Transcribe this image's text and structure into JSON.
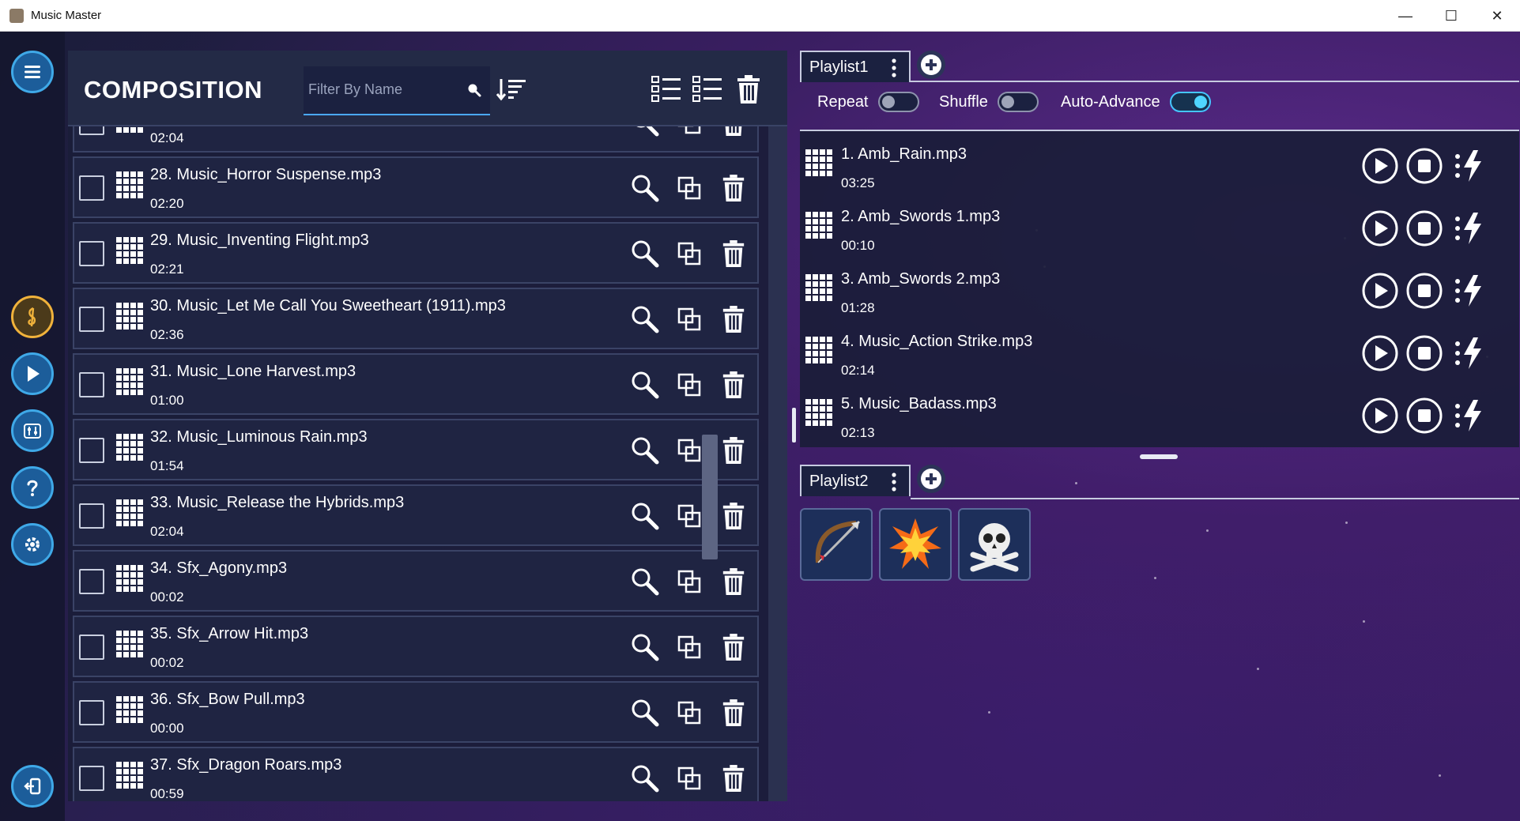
{
  "window": {
    "title": "Music Master",
    "minimize": "—",
    "maximize": "☐",
    "close": "✕"
  },
  "composition": {
    "title": "COMPOSITION",
    "filter_placeholder": "Filter By Name",
    "partial_top_row": {
      "duration": "02:04"
    },
    "tracks": [
      {
        "name": "28.  Music_Horror Suspense.mp3",
        "duration": "02:20"
      },
      {
        "name": "29.  Music_Inventing Flight.mp3",
        "duration": "02:21"
      },
      {
        "name": "30.  Music_Let Me Call You Sweetheart (1911).mp3",
        "duration": "02:36"
      },
      {
        "name": "31.  Music_Lone Harvest.mp3",
        "duration": "01:00"
      },
      {
        "name": "32.  Music_Luminous Rain.mp3",
        "duration": "01:54"
      },
      {
        "name": "33.  Music_Release the Hybrids.mp3",
        "duration": "02:04"
      },
      {
        "name": "34.  Sfx_Agony.mp3",
        "duration": "00:02"
      },
      {
        "name": "35.  Sfx_Arrow Hit.mp3",
        "duration": "00:02"
      },
      {
        "name": "36.  Sfx_Bow Pull.mp3",
        "duration": "00:00"
      },
      {
        "name": "37.  Sfx_Dragon Roars.mp3",
        "duration": "00:59"
      }
    ]
  },
  "playlist1": {
    "tab_label": "Playlist1",
    "toggles": [
      {
        "label": "Repeat",
        "on": false
      },
      {
        "label": "Shuffle",
        "on": false
      },
      {
        "label": "Auto-Advance",
        "on": true
      }
    ],
    "items": [
      {
        "name": "1.  Amb_Rain.mp3",
        "duration": "03:25"
      },
      {
        "name": "2.  Amb_Swords 1.mp3",
        "duration": "00:10"
      },
      {
        "name": "3.  Amb_Swords 2.mp3",
        "duration": "01:28"
      },
      {
        "name": "4.  Music_Action Strike.mp3",
        "duration": "02:14"
      },
      {
        "name": "5.  Music_Badass.mp3",
        "duration": "02:13"
      }
    ]
  },
  "playlist2": {
    "tab_label": "Playlist2",
    "tiles": [
      {
        "icon": "bow-arrow-icon"
      },
      {
        "icon": "explosion-icon"
      },
      {
        "icon": "skull-crossbones-icon"
      }
    ]
  },
  "colors": {
    "accent": "#3fa9e8",
    "toggle_on": "#4fd5ff",
    "gold": "#f0b23b"
  }
}
